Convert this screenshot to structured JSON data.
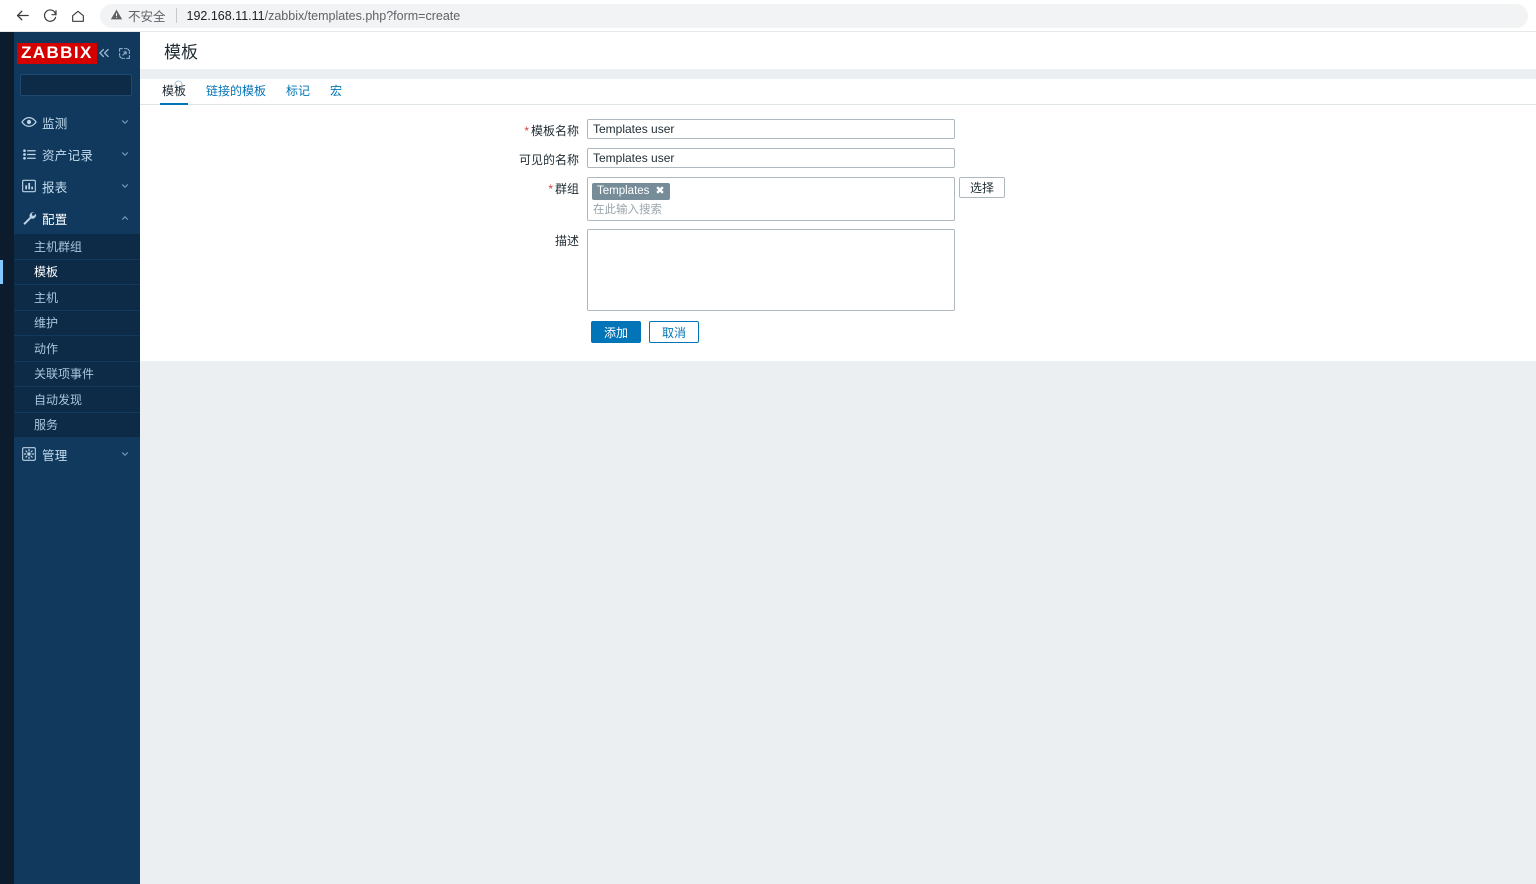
{
  "browser": {
    "back_icon": "arrow-left-icon",
    "reload_icon": "reload-icon",
    "home_icon": "home-icon",
    "security_icon": "warning-triangle-icon",
    "security_label": "不安全",
    "url_host": "192.168.11.11",
    "url_path": "/zabbix/templates.php?form=create",
    "url_full": "192.168.11.11/zabbix/templates.php?form=create"
  },
  "sidebar": {
    "logo": "ZABBIX",
    "collapse_icon": "chevron-double-left-icon",
    "hide_icon": "collapse-panel-icon",
    "search_placeholder": "",
    "search_value": "",
    "search_icon": "search-icon",
    "menu": [
      {
        "label": "监测",
        "icon": "eye-icon",
        "chevron": "chevron-down-icon",
        "active": false
      },
      {
        "label": "资产记录",
        "icon": "list-icon",
        "chevron": "chevron-down-icon",
        "active": false
      },
      {
        "label": "报表",
        "icon": "bar-chart-icon",
        "chevron": "chevron-down-icon",
        "active": false
      },
      {
        "label": "配置",
        "icon": "wrench-icon",
        "chevron": "chevron-up-icon",
        "active": true
      }
    ],
    "submenu": [
      {
        "label": "主机群组",
        "selected": false
      },
      {
        "label": "模板",
        "selected": true
      },
      {
        "label": "主机",
        "selected": false
      },
      {
        "label": "维护",
        "selected": false
      },
      {
        "label": "动作",
        "selected": false
      },
      {
        "label": "关联项事件",
        "selected": false
      },
      {
        "label": "自动发现",
        "selected": false
      },
      {
        "label": "服务",
        "selected": false
      }
    ],
    "admin": {
      "label": "管理",
      "icon": "gear-icon",
      "chevron": "chevron-down-icon"
    }
  },
  "page": {
    "title": "模板"
  },
  "tabs": [
    {
      "label": "模板",
      "active": true
    },
    {
      "label": "链接的模板",
      "active": false
    },
    {
      "label": "标记",
      "active": false
    },
    {
      "label": "宏",
      "active": false
    }
  ],
  "form": {
    "template_name": {
      "label": "模板名称",
      "required": true,
      "value": "Templates user",
      "placeholder": ""
    },
    "visible_name": {
      "label": "可见的名称",
      "required": false,
      "value": "Templates user",
      "placeholder": ""
    },
    "groups": {
      "label": "群组",
      "required": true,
      "chips": [
        {
          "text": "Templates",
          "remove_icon": "close-icon"
        }
      ],
      "search_placeholder": "在此输入搜索",
      "select_button": "选择"
    },
    "description": {
      "label": "描述",
      "required": false,
      "value": "",
      "placeholder": ""
    },
    "submit_label": "添加",
    "cancel_label": "取消"
  },
  "colors": {
    "brand_red": "#d40000",
    "sidebar_bg": "#10395d",
    "sidebar_dark": "#0c1c2c",
    "submenu_bg": "#0d2b47",
    "accent_blue": "#0275b8",
    "selected_bar": "#82c7ff",
    "chip_bg": "#768d99",
    "page_bg": "#ebeff2",
    "required_star": "#d43f3f"
  }
}
